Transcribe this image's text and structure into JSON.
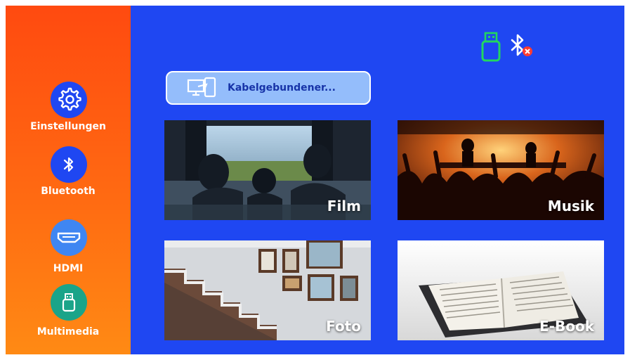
{
  "sidebar": {
    "items": [
      {
        "label": "Einstellungen",
        "icon": "gear-icon",
        "color": "#1f47f2"
      },
      {
        "label": "Bluetooth",
        "icon": "bluetooth-icon",
        "color": "#1f47f2"
      },
      {
        "label": "HDMI",
        "icon": "hdmi-icon",
        "color": "#3f86f2"
      },
      {
        "label": "Multimedia",
        "icon": "usb-icon",
        "color": "#1aa489"
      }
    ]
  },
  "status": {
    "usb_icon": "usb-drive-icon",
    "usb_color": "#22d660",
    "bluetooth_icon": "bluetooth-disconnected-icon"
  },
  "source": {
    "label": "Kabelgebundener...",
    "icon": "screen-mirroring-icon"
  },
  "tiles": [
    {
      "label": "Film"
    },
    {
      "label": "Musik"
    },
    {
      "label": "Foto"
    },
    {
      "label": "E-Book"
    }
  ]
}
